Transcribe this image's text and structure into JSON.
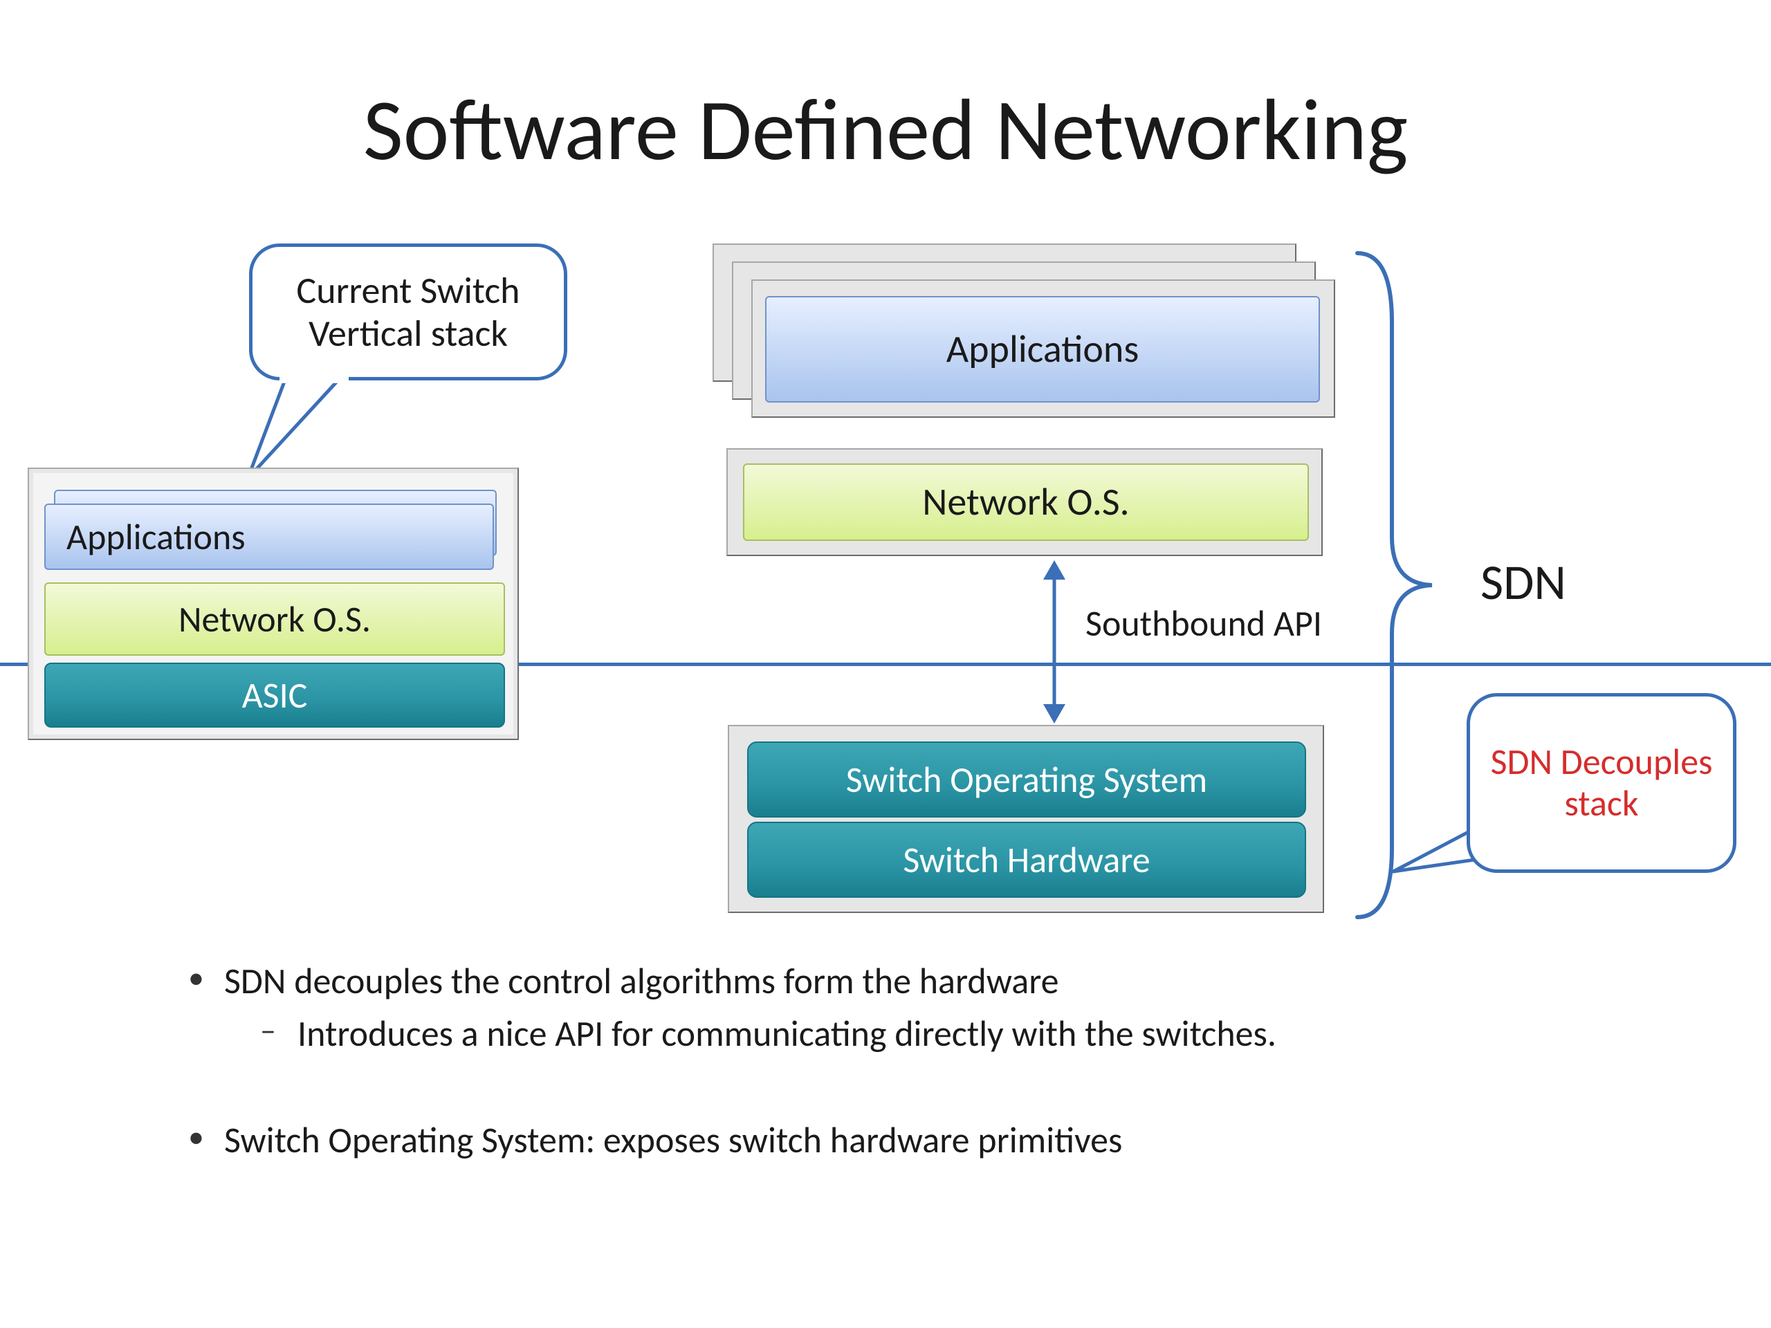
{
  "title": "Software Defined Networking",
  "callouts": {
    "left": "Current Switch Vertical stack",
    "right": "SDN Decouples stack"
  },
  "left_stack": {
    "applications": "Applications",
    "network_os": "Network O.S.",
    "asic": "ASIC"
  },
  "right": {
    "applications": "Applications",
    "network_os": "Network O.S.",
    "southbound_api": "Southbound API",
    "switch_os": "Switch Operating System",
    "switch_hw": "Switch Hardware",
    "brace_label": "SDN"
  },
  "bullets": {
    "b1": "SDN decouples the control algorithms form the hardware",
    "b1a": "Introduces a nice API for communicating directly with the switches.",
    "b2": "Switch Operating System: exposes switch hardware primitives"
  },
  "colors": {
    "accent_blue": "#3b6fb6",
    "box_blue_top": "#e7efff",
    "box_blue_bot": "#a9c4ee",
    "box_green_top": "#f2f9d8",
    "box_green_bot": "#d7ef8e",
    "box_teal": "#2a94a4",
    "red_text": "#d62c2c"
  }
}
